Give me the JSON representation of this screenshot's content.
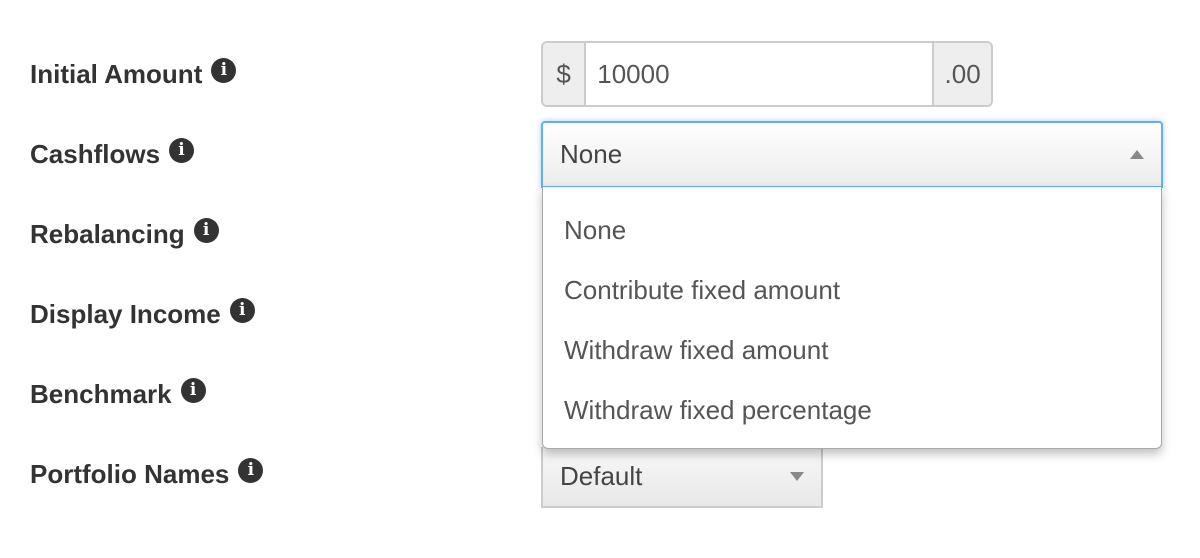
{
  "labels": [
    {
      "text": "Initial Amount",
      "icon": "info-icon"
    },
    {
      "text": "Cashflows",
      "icon": "info-icon"
    },
    {
      "text": "Rebalancing",
      "icon": "info-icon"
    },
    {
      "text": "Display Income",
      "icon": "info-icon"
    },
    {
      "text": "Benchmark",
      "icon": "info-icon"
    },
    {
      "text": "Portfolio Names",
      "icon": "info-icon"
    }
  ],
  "info_glyph": "i",
  "initial_amount": {
    "prefix": "$",
    "value": "10000",
    "suffix": ".00"
  },
  "cashflows": {
    "selected": "None",
    "options": [
      "None",
      "Contribute fixed amount",
      "Withdraw fixed amount",
      "Withdraw fixed percentage"
    ]
  },
  "portfolio_names": {
    "selected": "Default"
  },
  "colors": {
    "focus_border": "#66afe9",
    "label_text": "#333333"
  }
}
